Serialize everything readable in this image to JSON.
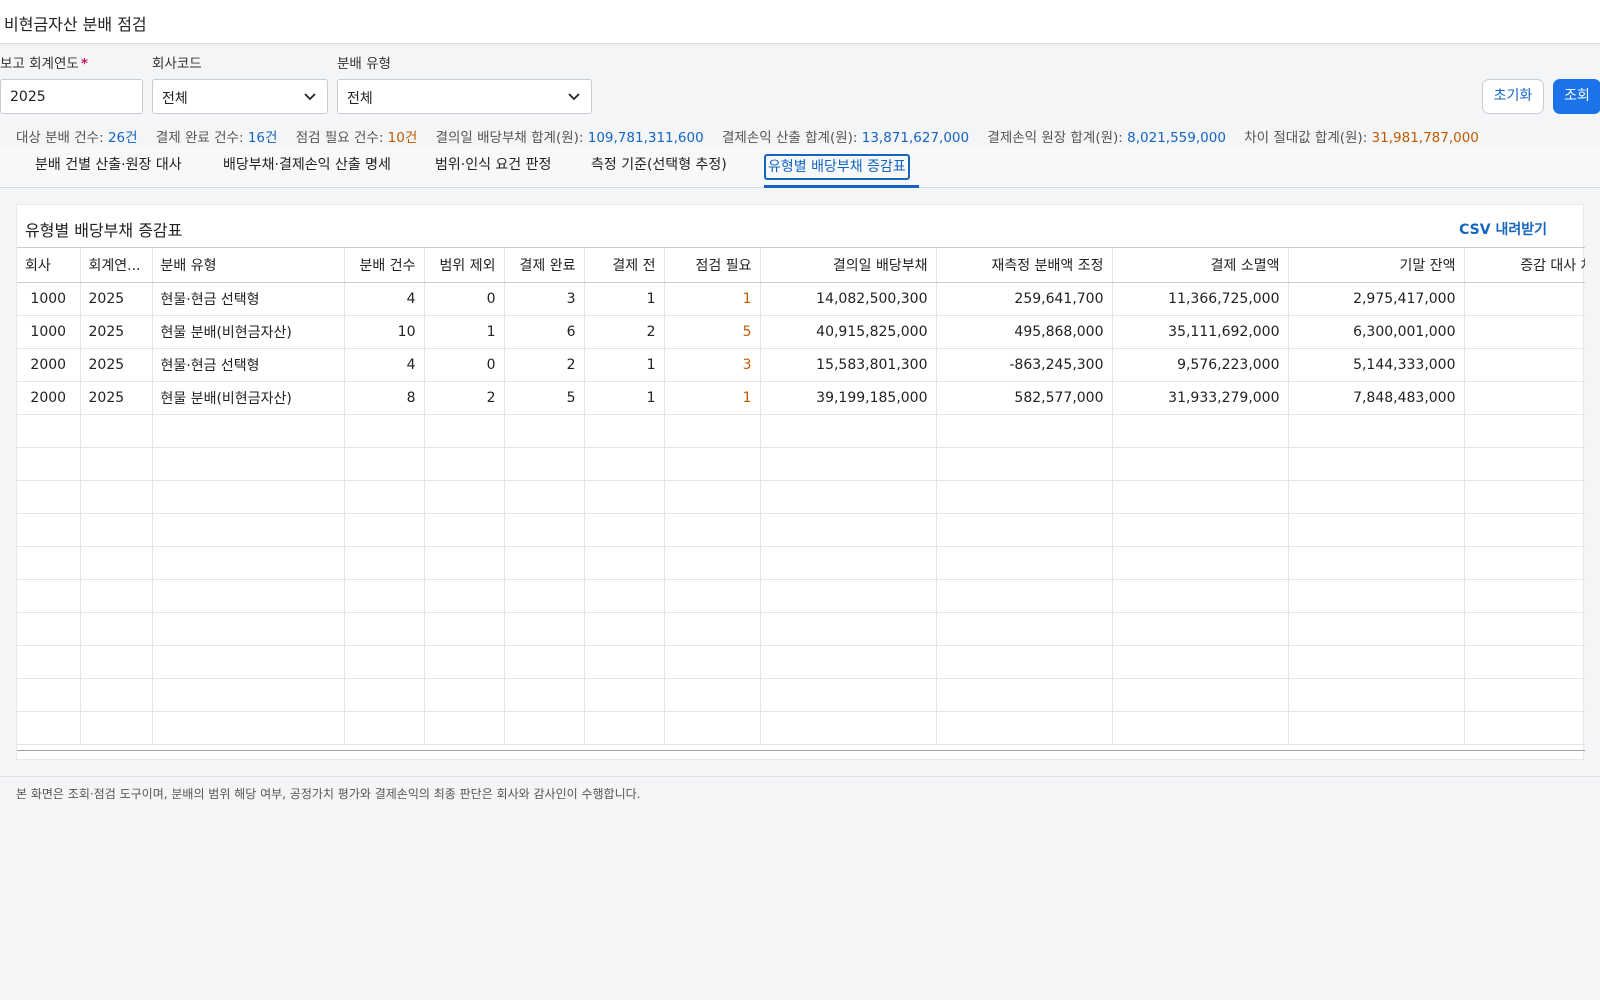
{
  "page": {
    "title": "비현금자산 분배 점검"
  },
  "filters": {
    "year_label": "보고 회계연도",
    "year_required_mark": "*",
    "year_value": "2025",
    "company_label": "회사코드",
    "company_value": "전체",
    "type_label": "분배 유형",
    "type_value": "전체"
  },
  "buttons": {
    "reset": "초기화",
    "search": "조회"
  },
  "summary": [
    {
      "label": "대상 분배 건수:",
      "value": "26건",
      "color": "#1565c0"
    },
    {
      "label": "결제 완료 건수:",
      "value": "16건",
      "color": "#1565c0"
    },
    {
      "label": "점검 필요 건수:",
      "value": "10건",
      "color": "#c05a00"
    },
    {
      "label": "결의일 배당부채 합계(원):",
      "value": "109,781,311,600",
      "color": "#1565c0"
    },
    {
      "label": "결제손익 산출 합계(원):",
      "value": "13,871,627,000",
      "color": "#1565c0"
    },
    {
      "label": "결제손익 원장 합계(원):",
      "value": "8,021,559,000",
      "color": "#1565c0"
    },
    {
      "label": "차이 절대값 합계(원):",
      "value": "31,981,787,000",
      "color": "#c05a00"
    }
  ],
  "tabs": [
    {
      "label": "분배 건별 산출·원장 대사"
    },
    {
      "label": "배당부채·결제손익 산출 명세"
    },
    {
      "label": "범위·인식 요건 판정"
    },
    {
      "label": "측정 기준(선택형 추정)"
    },
    {
      "label": "유형별 배당부채 증감표"
    }
  ],
  "panel": {
    "title": "유형별 배당부채 증감표",
    "csv_label": "CSV 내려받기"
  },
  "table": {
    "columns": [
      "회사",
      "회계연...",
      "분배 유형",
      "분배 건수",
      "범위 제외",
      "결제 완료",
      "결제 전",
      "점검 필요",
      "결의일 배당부채",
      "재측정 분배액 조정",
      "결제 소멸액",
      "기말 잔액",
      "증감 대사 차"
    ],
    "rows": [
      [
        "1000",
        "2025",
        "현물·현금 선택형",
        "4",
        "0",
        "3",
        "1",
        "1",
        "14,082,500,300",
        "259,641,700",
        "11,366,725,000",
        "2,975,417,000",
        ""
      ],
      [
        "1000",
        "2025",
        "현물 분배(비현금자산)",
        "10",
        "1",
        "6",
        "2",
        "5",
        "40,915,825,000",
        "495,868,000",
        "35,111,692,000",
        "6,300,001,000",
        ""
      ],
      [
        "2000",
        "2025",
        "현물·현금 선택형",
        "4",
        "0",
        "2",
        "1",
        "3",
        "15,583,801,300",
        "-863,245,300",
        "9,576,223,000",
        "5,144,333,000",
        ""
      ],
      [
        "2000",
        "2025",
        "현물 분배(비현금자산)",
        "8",
        "2",
        "5",
        "1",
        "1",
        "39,199,185,000",
        "582,577,000",
        "31,933,279,000",
        "7,848,483,000",
        ""
      ]
    ]
  },
  "footer": {
    "note": "본 화면은 조회·점검 도구이며, 분배의 범위 해당 여부, 공정가치 평가와 결제손익의 최종 판단은 회사와 감사인이 수행합니다."
  }
}
